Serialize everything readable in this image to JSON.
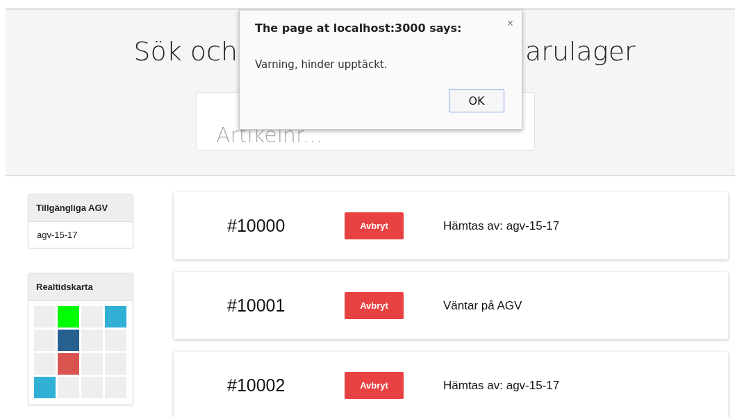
{
  "header": {
    "title_left": "Sök och",
    "title_right": "arulager",
    "search": {
      "placeholder": "Artikelnr..."
    }
  },
  "agv_panel": {
    "title": "Tillgängliga AGV",
    "items": [
      "agv-15-17"
    ]
  },
  "map_panel": {
    "title": "Realtidskarta",
    "cells": [
      {
        "color": "#eeeeee"
      },
      {
        "color": "#00ff00"
      },
      {
        "color": "#eeeeee"
      },
      {
        "color": "#31b0d5"
      },
      {
        "color": "#eeeeee"
      },
      {
        "color": "#286090"
      },
      {
        "color": "#eeeeee"
      },
      {
        "color": "#eeeeee"
      },
      {
        "color": "#eeeeee"
      },
      {
        "color": "#d9534f"
      },
      {
        "color": "#eeeeee"
      },
      {
        "color": "#eeeeee"
      },
      {
        "color": "#31b0d5"
      },
      {
        "color": "#eeeeee"
      },
      {
        "color": "#eeeeee"
      },
      {
        "color": "#eeeeee"
      }
    ]
  },
  "orders": [
    {
      "number": "#10000",
      "button": "Avbryt",
      "status": "Hämtas av: agv-15-17"
    },
    {
      "number": "#10001",
      "button": "Avbryt",
      "status": "Väntar på AGV"
    },
    {
      "number": "#10002",
      "button": "Avbryt",
      "status": "Hämtas av: agv-15-17"
    }
  ],
  "dialog": {
    "title": "The page at localhost:3000 says:",
    "close": "×",
    "message": "Varning, hinder upptäckt.",
    "button": "OK"
  }
}
